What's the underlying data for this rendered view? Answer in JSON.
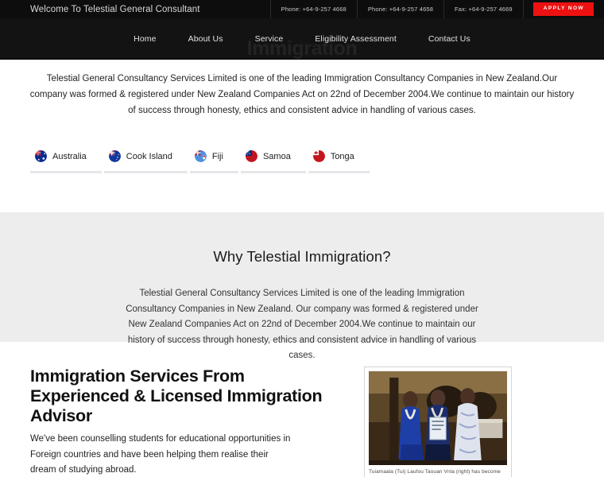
{
  "topbar": {
    "welcome": "Welcome To Telestial General Consultant",
    "contacts": [
      "Phone: +64-9-257 4668",
      "Phone: +64-9-257 4658",
      "Fax: +64-9-257 4669"
    ],
    "apply_label": "APPLY NOW"
  },
  "nav": {
    "watermark": "Immigration",
    "links": [
      {
        "label": "Home"
      },
      {
        "label": "About Us"
      },
      {
        "label": "Service"
      },
      {
        "label": "Eligibility Assessment"
      },
      {
        "label": "Contact Us"
      }
    ]
  },
  "intro": {
    "paragraph": "Telestial General Consultancy Services Limited is one of the leading Immigration Consultancy Companies in New Zealand.Our company was formed & registered under New Zealand Companies Act on 22nd of December 2004.We continue to maintain our history of success through honesty, ethics and consistent advice in handling of various cases."
  },
  "flags": [
    {
      "label": "Australia",
      "color": "#0a2a8f",
      "accent": "#d42026"
    },
    {
      "label": "Cook Island",
      "color": "#10379e",
      "accent": "#1d58d8"
    },
    {
      "label": "Fiji",
      "color": "#3d7fd6",
      "accent": "#1b4fa8"
    },
    {
      "label": "Samoa",
      "color": "#c2161f",
      "accent": "#0b2a7a"
    },
    {
      "label": "Tonga",
      "color": "#c4161c",
      "accent": "#ffffff"
    }
  ],
  "why": {
    "heading": "Why Telestial Immigration?",
    "paragraph": "Telestial General Consultancy Services Limited is one of the leading Immigration Consultancy Companies in New Zealand. Our company was formed & registered under New Zealand Companies Act on 22nd of December 2004.We continue to maintain our history of success through honesty, ethics and consistent advice in handling of various cases."
  },
  "services": {
    "heading": "Immigration Services From Experienced & Licensed Immigration Advisor",
    "paragraph": "We've been counselling students for educational opportunities in Foreign countries and have been helping them realise their dream of studying abroad.",
    "photo_caption": "Tuiamaala (Tui) Laufou Taouan Vnla (right) has become",
    "photo_alt": "three-women-award-ceremony-photo"
  },
  "colors": {
    "accent_red": "#ee1111",
    "dark_header": "#0d0d0d",
    "nav_dark": "#131313",
    "section_gray": "#ededed",
    "tab_underline": "#e4e6e9"
  }
}
